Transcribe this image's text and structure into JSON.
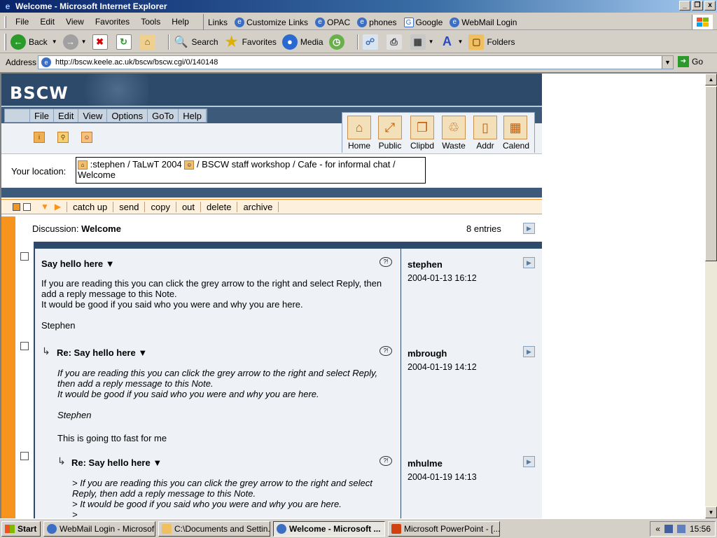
{
  "window": {
    "title": "Welcome - Microsoft Internet Explorer",
    "minimize": "_",
    "maximize": "❐",
    "close": "x"
  },
  "menubar": {
    "items": [
      "File",
      "Edit",
      "View",
      "Favorites",
      "Tools",
      "Help"
    ],
    "links_label": "Links",
    "links": [
      "Customize Links",
      "OPAC",
      "phones",
      "Google",
      "WebMail Login"
    ]
  },
  "toolbar": {
    "back": "Back",
    "search": "Search",
    "favorites": "Favorites",
    "media": "Media",
    "folders": "Folders"
  },
  "address": {
    "label": "Address",
    "url": "http://bscw.keele.ac.uk/bscw/bscw.cgi/0/140148",
    "go": "Go"
  },
  "bscw": {
    "logo": "BSCW",
    "menu": [
      "File",
      "Edit",
      "View",
      "Options",
      "GoTo",
      "Help"
    ],
    "quick": [
      {
        "label": "Home",
        "icon": "home-icon",
        "glyph": "⌂"
      },
      {
        "label": "Public",
        "icon": "public-icon",
        "glyph": "⤢"
      },
      {
        "label": "Clipbd",
        "icon": "clipboard-icon",
        "glyph": "❐"
      },
      {
        "label": "Waste",
        "icon": "waste-icon",
        "glyph": "♲"
      },
      {
        "label": "Addr",
        "icon": "address-book-icon",
        "glyph": "▯"
      },
      {
        "label": "Calend",
        "icon": "calendar-icon",
        "glyph": "▦"
      }
    ],
    "location_label": "Your location:",
    "location_part1": ":stephen / TaLwT 2004",
    "location_part2": "/ BSCW staff workshop / Cafe - for informal chat /",
    "location_part3": "Welcome",
    "actions": [
      "catch up",
      "send",
      "copy",
      "out",
      "delete",
      "archive"
    ],
    "discussion_label": "Discussion:",
    "discussion_name": "Welcome",
    "entries": "8 entries"
  },
  "notes": [
    {
      "title": "Say hello here ▼",
      "text": "If you are reading this you can click the grey arrow to the right and select Reply, then\nadd a reply message to this Note.\nIt would be good if you said who you were and why you are here.\n\nStephen",
      "author": "stephen",
      "date": "2004-01-13 16:12"
    },
    {
      "title": "Re: Say hello here ▼",
      "quote": "If you are reading this you can click the grey arrow to the right and select Reply,\nthen add a reply message to this Note.\nIt would be good if you said who you were and why you are here.\n\nStephen",
      "text": "This is going tto fast for me",
      "author": "mbrough",
      "date": "2004-01-19 14:12"
    },
    {
      "title": "Re: Say hello here ▼",
      "quote": "> If you are reading this you can click the grey arrow to the right and select\nReply, then add a reply message to this Note.\n> It would be good if you said who you were and why you are here.\n>",
      "author": "mhulme",
      "date": "2004-01-19 14:13"
    }
  ],
  "taskbar": {
    "start": "Start",
    "tasks": [
      "WebMail Login - Microsof...",
      "C:\\Documents and Settin...",
      "Welcome - Microsoft ...",
      "Microsoft PowerPoint - [..."
    ],
    "clock": "15:56",
    "tray_arrow": "«"
  }
}
